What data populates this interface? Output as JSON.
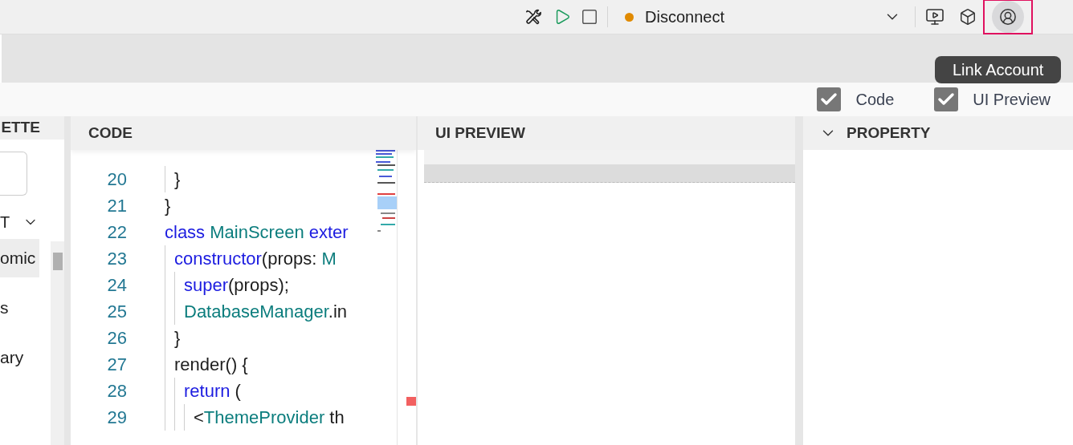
{
  "toolbar": {
    "connection": {
      "label": "Disconnect",
      "color": "#e08a00"
    },
    "account_focused": true,
    "tooltip": "Link Account"
  },
  "view_toggles": [
    {
      "label": "Code",
      "checked": true
    },
    {
      "label": "UI Preview",
      "checked": true
    }
  ],
  "palette": {
    "title": "ETTE",
    "section": {
      "label": "T",
      "expanded": true
    },
    "items": [
      {
        "label": "omic",
        "selected": true
      },
      {
        "label": "s",
        "selected": false
      },
      {
        "label": "ary",
        "selected": false
      }
    ]
  },
  "code": {
    "title": "CODE",
    "lines": [
      {
        "children": [
          {
            "number": "20",
            "tokens": [
              {
                "kind": "plain",
                "text": "}"
              }
            ]
          }
        ]
      },
      {
        "number": "21",
        "tokens": [
          {
            "kind": "plain",
            "text": "}"
          }
        ]
      },
      {
        "number": "22",
        "tokens": [
          {
            "kind": "keyword",
            "text": "class "
          },
          {
            "kind": "type",
            "text": "MainScreen"
          },
          {
            "kind": "keyword",
            "text": " exter"
          }
        ],
        "children": [
          {
            "number": "23",
            "tokens": [
              {
                "kind": "keyword",
                "text": "constructor"
              },
              {
                "kind": "plain",
                "text": "(props: "
              },
              {
                "kind": "type",
                "text": "M"
              }
            ],
            "children": [
              {
                "number": "24",
                "tokens": [
                  {
                    "kind": "keyword",
                    "text": "super"
                  },
                  {
                    "kind": "plain",
                    "text": "(props);"
                  }
                ]
              },
              {
                "number": "25",
                "tokens": [
                  {
                    "kind": "type",
                    "text": "DatabaseManager"
                  },
                  {
                    "kind": "plain",
                    "text": ".in"
                  }
                ]
              }
            ]
          },
          {
            "number": "26",
            "tokens": [
              {
                "kind": "plain",
                "text": "}"
              }
            ]
          },
          {
            "number": "27",
            "tokens": [
              {
                "kind": "plain",
                "text": "render() {"
              }
            ],
            "children": [
              {
                "number": "28",
                "tokens": [
                  {
                    "kind": "keyword",
                    "text": "return"
                  },
                  {
                    "kind": "plain",
                    "text": " ("
                  }
                ],
                "children": [
                  {
                    "number": "29",
                    "tokens": [
                      {
                        "kind": "plain",
                        "text": "<"
                      },
                      {
                        "kind": "type",
                        "text": "ThemeProvider"
                      },
                      {
                        "kind": "plain",
                        "text": " th"
                      }
                    ]
                  }
                ]
              }
            ]
          }
        ]
      }
    ]
  },
  "preview": {
    "title": "UI PREVIEW"
  },
  "property": {
    "title": "PROPERTY",
    "expanded": true
  }
}
